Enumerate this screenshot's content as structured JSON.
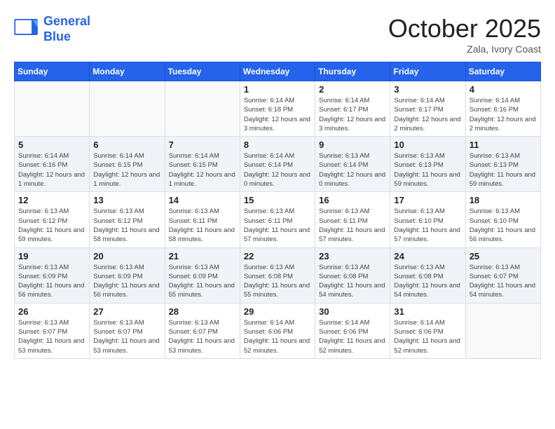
{
  "header": {
    "logo_line1": "General",
    "logo_line2": "Blue",
    "month": "October 2025",
    "location": "Zala, Ivory Coast"
  },
  "weekdays": [
    "Sunday",
    "Monday",
    "Tuesday",
    "Wednesday",
    "Thursday",
    "Friday",
    "Saturday"
  ],
  "weeks": [
    [
      {
        "day": "",
        "info": ""
      },
      {
        "day": "",
        "info": ""
      },
      {
        "day": "",
        "info": ""
      },
      {
        "day": "1",
        "info": "Sunrise: 6:14 AM\nSunset: 6:18 PM\nDaylight: 12 hours and 3 minutes."
      },
      {
        "day": "2",
        "info": "Sunrise: 6:14 AM\nSunset: 6:17 PM\nDaylight: 12 hours and 3 minutes."
      },
      {
        "day": "3",
        "info": "Sunrise: 6:14 AM\nSunset: 6:17 PM\nDaylight: 12 hours and 2 minutes."
      },
      {
        "day": "4",
        "info": "Sunrise: 6:14 AM\nSunset: 6:16 PM\nDaylight: 12 hours and 2 minutes."
      }
    ],
    [
      {
        "day": "5",
        "info": "Sunrise: 6:14 AM\nSunset: 6:16 PM\nDaylight: 12 hours and 1 minute."
      },
      {
        "day": "6",
        "info": "Sunrise: 6:14 AM\nSunset: 6:15 PM\nDaylight: 12 hours and 1 minute."
      },
      {
        "day": "7",
        "info": "Sunrise: 6:14 AM\nSunset: 6:15 PM\nDaylight: 12 hours and 1 minute."
      },
      {
        "day": "8",
        "info": "Sunrise: 6:14 AM\nSunset: 6:14 PM\nDaylight: 12 hours and 0 minutes."
      },
      {
        "day": "9",
        "info": "Sunrise: 6:13 AM\nSunset: 6:14 PM\nDaylight: 12 hours and 0 minutes."
      },
      {
        "day": "10",
        "info": "Sunrise: 6:13 AM\nSunset: 6:13 PM\nDaylight: 11 hours and 59 minutes."
      },
      {
        "day": "11",
        "info": "Sunrise: 6:13 AM\nSunset: 6:13 PM\nDaylight: 11 hours and 59 minutes."
      }
    ],
    [
      {
        "day": "12",
        "info": "Sunrise: 6:13 AM\nSunset: 6:12 PM\nDaylight: 11 hours and 59 minutes."
      },
      {
        "day": "13",
        "info": "Sunrise: 6:13 AM\nSunset: 6:12 PM\nDaylight: 11 hours and 58 minutes."
      },
      {
        "day": "14",
        "info": "Sunrise: 6:13 AM\nSunset: 6:11 PM\nDaylight: 11 hours and 58 minutes."
      },
      {
        "day": "15",
        "info": "Sunrise: 6:13 AM\nSunset: 6:11 PM\nDaylight: 11 hours and 57 minutes."
      },
      {
        "day": "16",
        "info": "Sunrise: 6:13 AM\nSunset: 6:11 PM\nDaylight: 11 hours and 57 minutes."
      },
      {
        "day": "17",
        "info": "Sunrise: 6:13 AM\nSunset: 6:10 PM\nDaylight: 11 hours and 57 minutes."
      },
      {
        "day": "18",
        "info": "Sunrise: 6:13 AM\nSunset: 6:10 PM\nDaylight: 11 hours and 56 minutes."
      }
    ],
    [
      {
        "day": "19",
        "info": "Sunrise: 6:13 AM\nSunset: 6:09 PM\nDaylight: 11 hours and 56 minutes."
      },
      {
        "day": "20",
        "info": "Sunrise: 6:13 AM\nSunset: 6:09 PM\nDaylight: 11 hours and 56 minutes."
      },
      {
        "day": "21",
        "info": "Sunrise: 6:13 AM\nSunset: 6:09 PM\nDaylight: 11 hours and 55 minutes."
      },
      {
        "day": "22",
        "info": "Sunrise: 6:13 AM\nSunset: 6:08 PM\nDaylight: 11 hours and 55 minutes."
      },
      {
        "day": "23",
        "info": "Sunrise: 6:13 AM\nSunset: 6:08 PM\nDaylight: 11 hours and 54 minutes."
      },
      {
        "day": "24",
        "info": "Sunrise: 6:13 AM\nSunset: 6:08 PM\nDaylight: 11 hours and 54 minutes."
      },
      {
        "day": "25",
        "info": "Sunrise: 6:13 AM\nSunset: 6:07 PM\nDaylight: 11 hours and 54 minutes."
      }
    ],
    [
      {
        "day": "26",
        "info": "Sunrise: 6:13 AM\nSunset: 6:07 PM\nDaylight: 11 hours and 53 minutes."
      },
      {
        "day": "27",
        "info": "Sunrise: 6:13 AM\nSunset: 6:07 PM\nDaylight: 11 hours and 53 minutes."
      },
      {
        "day": "28",
        "info": "Sunrise: 6:13 AM\nSunset: 6:07 PM\nDaylight: 11 hours and 53 minutes."
      },
      {
        "day": "29",
        "info": "Sunrise: 6:14 AM\nSunset: 6:06 PM\nDaylight: 11 hours and 52 minutes."
      },
      {
        "day": "30",
        "info": "Sunrise: 6:14 AM\nSunset: 6:06 PM\nDaylight: 11 hours and 52 minutes."
      },
      {
        "day": "31",
        "info": "Sunrise: 6:14 AM\nSunset: 6:06 PM\nDaylight: 11 hours and 52 minutes."
      },
      {
        "day": "",
        "info": ""
      }
    ]
  ]
}
